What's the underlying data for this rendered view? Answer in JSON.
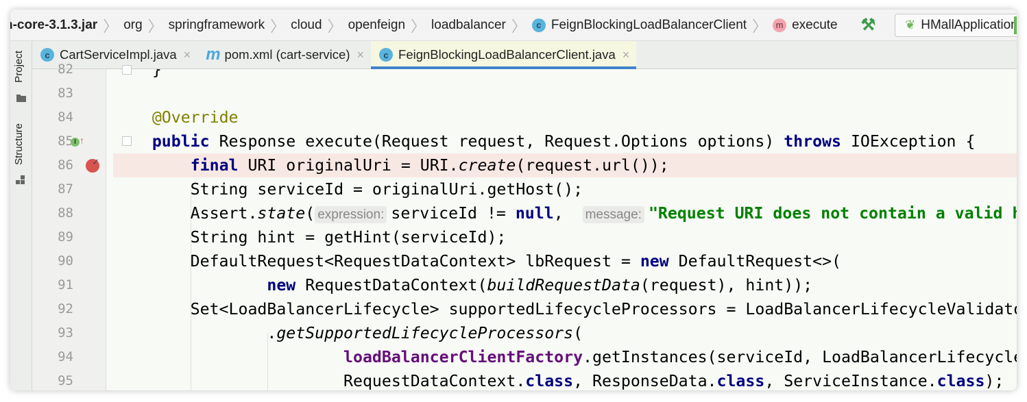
{
  "breadcrumbs": [
    {
      "label": "n-core-3.1.3.jar",
      "icon": null
    },
    {
      "label": "org"
    },
    {
      "label": "springframework"
    },
    {
      "label": "cloud"
    },
    {
      "label": "openfeign"
    },
    {
      "label": "loadbalancer"
    },
    {
      "label": "FeignBlockingLoadBalancerClient",
      "icon": "class-icon"
    },
    {
      "label": "execute",
      "icon": "method-icon"
    }
  ],
  "class_icon_letter": "c",
  "method_icon_letter": "m",
  "toolbar": {
    "build_icon": "hammer-icon",
    "run_config": "HMallApplication"
  },
  "side_tools": [
    "Project",
    "Structure"
  ],
  "tabs": [
    {
      "label": "CartServiceImpl.java",
      "icon": "class-icon",
      "active": false
    },
    {
      "label": "pom.xml (cart-service)",
      "icon": "maven-icon",
      "active": false
    },
    {
      "label": "FeignBlockingLoadBalancerClient.java",
      "icon": "class-locked-icon",
      "active": true
    }
  ],
  "maven_letter": "m",
  "close_glyph": "×",
  "colors": {
    "keyword": "#000080",
    "annotation": "#808000",
    "string": "#008000",
    "field": "#660e7a",
    "active_tab_underline": "#4083c9",
    "highlight_line": "#f8e8e3"
  },
  "code": [
    {
      "n": "82",
      "t": [
        [
          "    }",
          ""
        ]
      ]
    },
    {
      "n": "83",
      "t": []
    },
    {
      "n": "84",
      "t": [
        [
          "    ",
          ""
        ],
        [
          "@Override",
          "ann"
        ]
      ]
    },
    {
      "n": "85",
      "t": [
        [
          "    ",
          ""
        ],
        [
          "public",
          "kw"
        ],
        [
          " Response execute(Request request, Request.Options options) ",
          ""
        ],
        [
          "throws",
          "kw"
        ],
        [
          " IOException {",
          ""
        ]
      ],
      "gutter": "implements-override-icon"
    },
    {
      "n": "86",
      "t": [
        [
          "        ",
          ""
        ],
        [
          "final",
          "kw"
        ],
        [
          " URI originalUri = URI.",
          ""
        ],
        [
          "create",
          "it"
        ],
        [
          "(request.url());",
          ""
        ]
      ],
      "gutter": "breakpoint-icon",
      "highlight": true
    },
    {
      "n": "87",
      "t": [
        [
          "        String serviceId = originalUri.getHost();",
          ""
        ]
      ]
    },
    {
      "n": "88",
      "t": [
        [
          "        Assert.",
          ""
        ],
        [
          "state",
          "it"
        ],
        [
          "(",
          ""
        ],
        [
          "expression:",
          "hint"
        ],
        [
          "serviceId != ",
          ""
        ],
        [
          "null",
          "kw"
        ],
        [
          ",  ",
          ""
        ],
        [
          "message:",
          "hint"
        ],
        [
          "\"Request URI does not contain a valid h",
          "str"
        ]
      ]
    },
    {
      "n": "89",
      "t": [
        [
          "        String hint = getHint(serviceId);",
          ""
        ]
      ]
    },
    {
      "n": "90",
      "t": [
        [
          "        DefaultRequest<RequestDataContext> lbRequest = ",
          ""
        ],
        [
          "new",
          "kw"
        ],
        [
          " DefaultRequest<>(",
          ""
        ]
      ]
    },
    {
      "n": "91",
      "t": [
        [
          "                ",
          ""
        ],
        [
          "new",
          "kw"
        ],
        [
          " RequestDataContext(",
          ""
        ],
        [
          "buildRequestData",
          "it"
        ],
        [
          "(request), hint));",
          ""
        ]
      ]
    },
    {
      "n": "92",
      "t": [
        [
          "        Set<LoadBalancerLifecycle> supportedLifecycleProcessors = LoadBalancerLifecycleValidato",
          ""
        ]
      ]
    },
    {
      "n": "93",
      "t": [
        [
          "                .",
          ""
        ],
        [
          "getSupportedLifecycleProcessors",
          "it"
        ],
        [
          "(",
          ""
        ]
      ]
    },
    {
      "n": "94",
      "t": [
        [
          "                        ",
          ""
        ],
        [
          "loadBalancerClientFactory",
          "fld"
        ],
        [
          ".getInstances(serviceId, LoadBalancerLifecycle",
          ""
        ]
      ]
    },
    {
      "n": "95",
      "t": [
        [
          "                        RequestDataContext.",
          ""
        ],
        [
          "class",
          "kw"
        ],
        [
          ", ResponseData.",
          ""
        ],
        [
          "class",
          "kw"
        ],
        [
          ", ServiceInstance.",
          ""
        ],
        [
          "class",
          "kw"
        ],
        [
          ");",
          ""
        ]
      ]
    }
  ]
}
